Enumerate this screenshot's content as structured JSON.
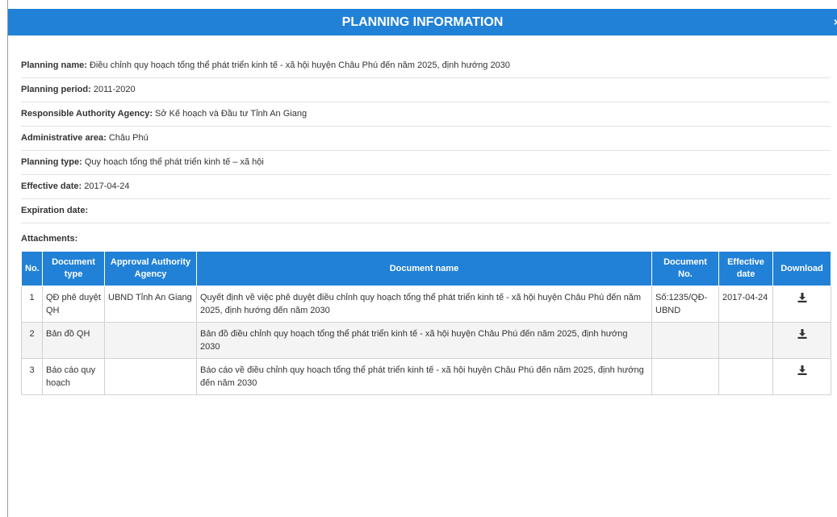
{
  "dialog": {
    "title": "PLANNING INFORMATION",
    "close_symbol": "×"
  },
  "fields": [
    {
      "label": "Planning name:",
      "value": "Điều chỉnh quy hoạch tổng thể phát triển kinh tế - xã hội huyện Châu Phú đến năm 2025, định hướng 2030"
    },
    {
      "label": "Planning period:",
      "value": "2011-2020"
    },
    {
      "label": "Responsible Authority Agency:",
      "value": "Sở Kế hoạch và Đầu tư Tỉnh An Giang"
    },
    {
      "label": "Administrative area:",
      "value": "Châu Phú"
    },
    {
      "label": "Planning type:",
      "value": "Quy hoạch tổng thể phát triển kinh tế – xã hội"
    },
    {
      "label": "Effective date:",
      "value": "2017-04-24"
    },
    {
      "label": "Expiration date:",
      "value": ""
    }
  ],
  "attachments": {
    "title": "Attachments:",
    "columns": [
      "No.",
      "Document type",
      "Approval Authority Agency",
      "Document name",
      "Document No.",
      "Effective date",
      "Download"
    ],
    "rows": [
      {
        "no": "1",
        "type": "QĐ phê duyệt QH",
        "agency": "UBND Tỉnh An Giang",
        "name": "Quyết định về việc phê duyệt điều chỉnh quy hoạch tổng thể phát triển kinh tế - xã hội huyện Châu Phú đến năm 2025, định hướng đến năm 2030",
        "doc_no": "Số:1235/QĐ-UBND",
        "date": "2017-04-24",
        "download_icon": "download-icon"
      },
      {
        "no": "2",
        "type": "Bản đồ QH",
        "agency": "",
        "name": "Bản đồ điều chỉnh quy hoạch tổng thể phát triển kinh tế - xã hội huyện Châu Phú đến năm 2025, định hướng 2030",
        "doc_no": "",
        "date": "",
        "download_icon": "download-icon"
      },
      {
        "no": "3",
        "type": "Báo cáo quy hoạch",
        "agency": "",
        "name": "Báo cáo về điều chỉnh quy hoạch tổng thể phát triển kinh tế - xã hội huyện Châu Phú đến năm 2025, định hướng đến năm 2030",
        "doc_no": "",
        "date": "",
        "download_icon": "download-icon"
      }
    ]
  },
  "colors": {
    "header_bg": "#2181d6",
    "header_text": "#ffffff",
    "row_alt_bg": "#f4f4f4"
  }
}
